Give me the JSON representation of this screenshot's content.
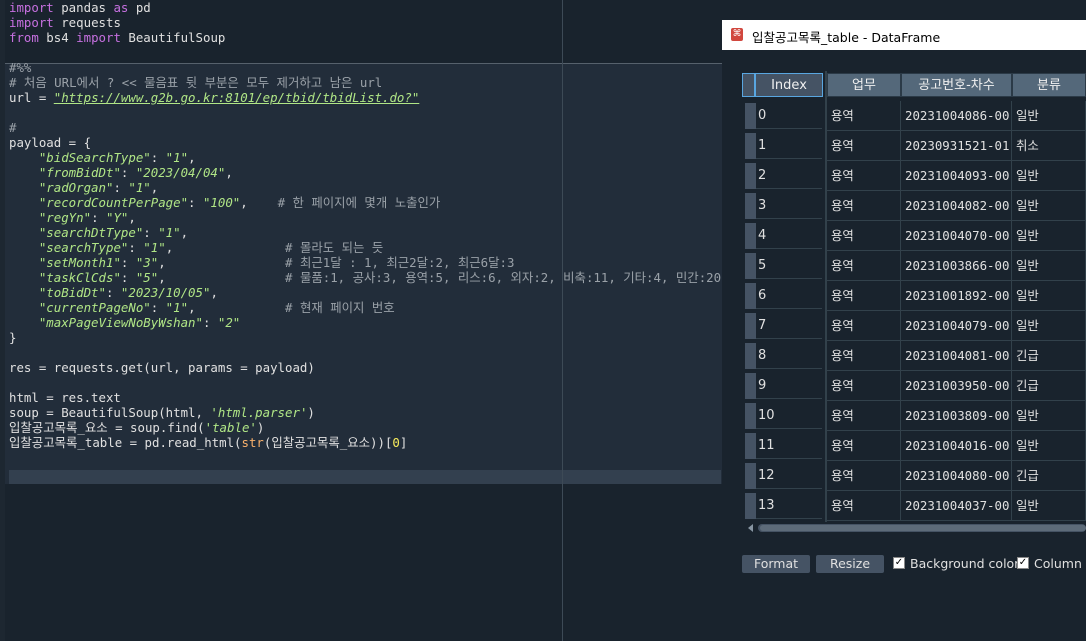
{
  "editor": {
    "lines": [
      [
        {
          "t": "import",
          "c": "kw"
        },
        {
          "t": " pandas "
        },
        {
          "t": "as",
          "c": "kw"
        },
        {
          "t": " pd"
        }
      ],
      [
        {
          "t": "import",
          "c": "kw"
        },
        {
          "t": " requests"
        }
      ],
      [
        {
          "t": "from",
          "c": "kw"
        },
        {
          "t": " bs4 "
        },
        {
          "t": "import",
          "c": "kw"
        },
        {
          "t": " BeautifulSoup"
        }
      ],
      [],
      [
        {
          "t": "#%%",
          "c": "cm"
        }
      ],
      [
        {
          "t": "# 처음 URL에서 ? << 물음표 뒷 부분은 모두 제거하고 남은 url",
          "c": "cm"
        }
      ],
      [
        {
          "t": "url = "
        },
        {
          "t": "\"https://www.g2b.go.kr:8101/ep/tbid/tbidList.do?\"",
          "c": "str url"
        }
      ],
      [],
      [
        {
          "t": "#",
          "c": "cm"
        }
      ],
      [
        {
          "t": "payload = {"
        }
      ],
      [
        {
          "t": "    "
        },
        {
          "t": "\"bidSearchType\"",
          "c": "str"
        },
        {
          "t": ": "
        },
        {
          "t": "\"1\"",
          "c": "str"
        },
        {
          "t": ","
        }
      ],
      [
        {
          "t": "    "
        },
        {
          "t": "\"fromBidDt\"",
          "c": "str"
        },
        {
          "t": ": "
        },
        {
          "t": "\"2023/04/04\"",
          "c": "str"
        },
        {
          "t": ","
        }
      ],
      [
        {
          "t": "    "
        },
        {
          "t": "\"radOrgan\"",
          "c": "str"
        },
        {
          "t": ": "
        },
        {
          "t": "\"1\"",
          "c": "str"
        },
        {
          "t": ","
        }
      ],
      [
        {
          "t": "    "
        },
        {
          "t": "\"recordCountPerPage\"",
          "c": "str"
        },
        {
          "t": ": "
        },
        {
          "t": "\"100\"",
          "c": "str"
        },
        {
          "t": ",    "
        },
        {
          "t": "# 한 페이지에 몇개 노출인가",
          "c": "cm"
        }
      ],
      [
        {
          "t": "    "
        },
        {
          "t": "\"regYn\"",
          "c": "str"
        },
        {
          "t": ": "
        },
        {
          "t": "\"Y\"",
          "c": "str"
        },
        {
          "t": ","
        }
      ],
      [
        {
          "t": "    "
        },
        {
          "t": "\"searchDtType\"",
          "c": "str"
        },
        {
          "t": ": "
        },
        {
          "t": "\"1\"",
          "c": "str"
        },
        {
          "t": ","
        }
      ],
      [
        {
          "t": "    "
        },
        {
          "t": "\"searchType\"",
          "c": "str"
        },
        {
          "t": ": "
        },
        {
          "t": "\"1\"",
          "c": "str"
        },
        {
          "t": ",               "
        },
        {
          "t": "# 몰라도 되는 듯",
          "c": "cm"
        }
      ],
      [
        {
          "t": "    "
        },
        {
          "t": "\"setMonth1\"",
          "c": "str"
        },
        {
          "t": ": "
        },
        {
          "t": "\"3\"",
          "c": "str"
        },
        {
          "t": ",                "
        },
        {
          "t": "# 최근1달 : 1, 최근2달:2, 최근6달:3",
          "c": "cm"
        }
      ],
      [
        {
          "t": "    "
        },
        {
          "t": "\"taskClCds\"",
          "c": "str"
        },
        {
          "t": ": "
        },
        {
          "t": "\"5\"",
          "c": "str"
        },
        {
          "t": ",                "
        },
        {
          "t": "# 물품:1, 공사:3, 용역:5, 리스:6, 외자:2, 비축:11, 기타:4, 민간:20",
          "c": "cm"
        }
      ],
      [
        {
          "t": "    "
        },
        {
          "t": "\"toBidDt\"",
          "c": "str"
        },
        {
          "t": ": "
        },
        {
          "t": "\"2023/10/05\"",
          "c": "str"
        },
        {
          "t": ","
        }
      ],
      [
        {
          "t": "    "
        },
        {
          "t": "\"currentPageNo\"",
          "c": "str"
        },
        {
          "t": ": "
        },
        {
          "t": "\"1\"",
          "c": "str"
        },
        {
          "t": ",            "
        },
        {
          "t": "# 현재 페이지 번호",
          "c": "cm"
        }
      ],
      [
        {
          "t": "    "
        },
        {
          "t": "\"maxPageViewNoByWshan\"",
          "c": "str"
        },
        {
          "t": ": "
        },
        {
          "t": "\"2\"",
          "c": "str"
        }
      ],
      [
        {
          "t": "}"
        }
      ],
      [],
      [
        {
          "t": "res = requests.get(url, params = payload)"
        }
      ],
      [],
      [
        {
          "t": "html = res.text"
        }
      ],
      [
        {
          "t": "soup = BeautifulSoup(html, "
        },
        {
          "t": "'html.parser'",
          "c": "str"
        },
        {
          "t": ")"
        }
      ],
      [
        {
          "t": "입찰공고목록_요소 = soup.find("
        },
        {
          "t": "'table'",
          "c": "str"
        },
        {
          "t": ")"
        }
      ],
      [
        {
          "t": "입찰공고목록_table = pd.read_html("
        },
        {
          "t": "str",
          "c": "bi"
        },
        {
          "t": "(입찰공고목록_요소))["
        },
        {
          "t": "0",
          "c": "num"
        },
        {
          "t": "]"
        }
      ],
      []
    ]
  },
  "window": {
    "title": "입찰공고목록_table - DataFrame",
    "icon": "app-icon"
  },
  "table": {
    "headers": {
      "index": "Index",
      "c1": "업무",
      "c2": "공고번호-차수",
      "c3": "분류"
    },
    "rows": [
      {
        "index": "0",
        "c1": "용역",
        "c2": "20231004086-00",
        "c3": "일반"
      },
      {
        "index": "1",
        "c1": "용역",
        "c2": "20230931521-01",
        "c3": "취소"
      },
      {
        "index": "2",
        "c1": "용역",
        "c2": "20231004093-00",
        "c3": "일반"
      },
      {
        "index": "3",
        "c1": "용역",
        "c2": "20231004082-00",
        "c3": "일반"
      },
      {
        "index": "4",
        "c1": "용역",
        "c2": "20231004070-00",
        "c3": "일반"
      },
      {
        "index": "5",
        "c1": "용역",
        "c2": "20231003866-00",
        "c3": "일반"
      },
      {
        "index": "6",
        "c1": "용역",
        "c2": "20231001892-00",
        "c3": "일반"
      },
      {
        "index": "7",
        "c1": "용역",
        "c2": "20231004079-00",
        "c3": "일반"
      },
      {
        "index": "8",
        "c1": "용역",
        "c2": "20231004081-00",
        "c3": "긴급"
      },
      {
        "index": "9",
        "c1": "용역",
        "c2": "20231003950-00",
        "c3": "긴급"
      },
      {
        "index": "10",
        "c1": "용역",
        "c2": "20231003809-00",
        "c3": "일반"
      },
      {
        "index": "11",
        "c1": "용역",
        "c2": "20231004016-00",
        "c3": "일반"
      },
      {
        "index": "12",
        "c1": "용역",
        "c2": "20231004080-00",
        "c3": "긴급"
      },
      {
        "index": "13",
        "c1": "용역",
        "c2": "20231004037-00",
        "c3": "일반"
      }
    ]
  },
  "footer": {
    "format_label": "Format",
    "resize_label": "Resize",
    "background_label": "Background color",
    "column_label": "Column n",
    "checkmark": "✓"
  },
  "colors": {
    "editor_bg": "#19232d",
    "keyword": "#c670e0",
    "string": "#b0e686",
    "comment": "#9aa1a8",
    "header_bg": "#54687a",
    "accent": "#59a6e0"
  }
}
